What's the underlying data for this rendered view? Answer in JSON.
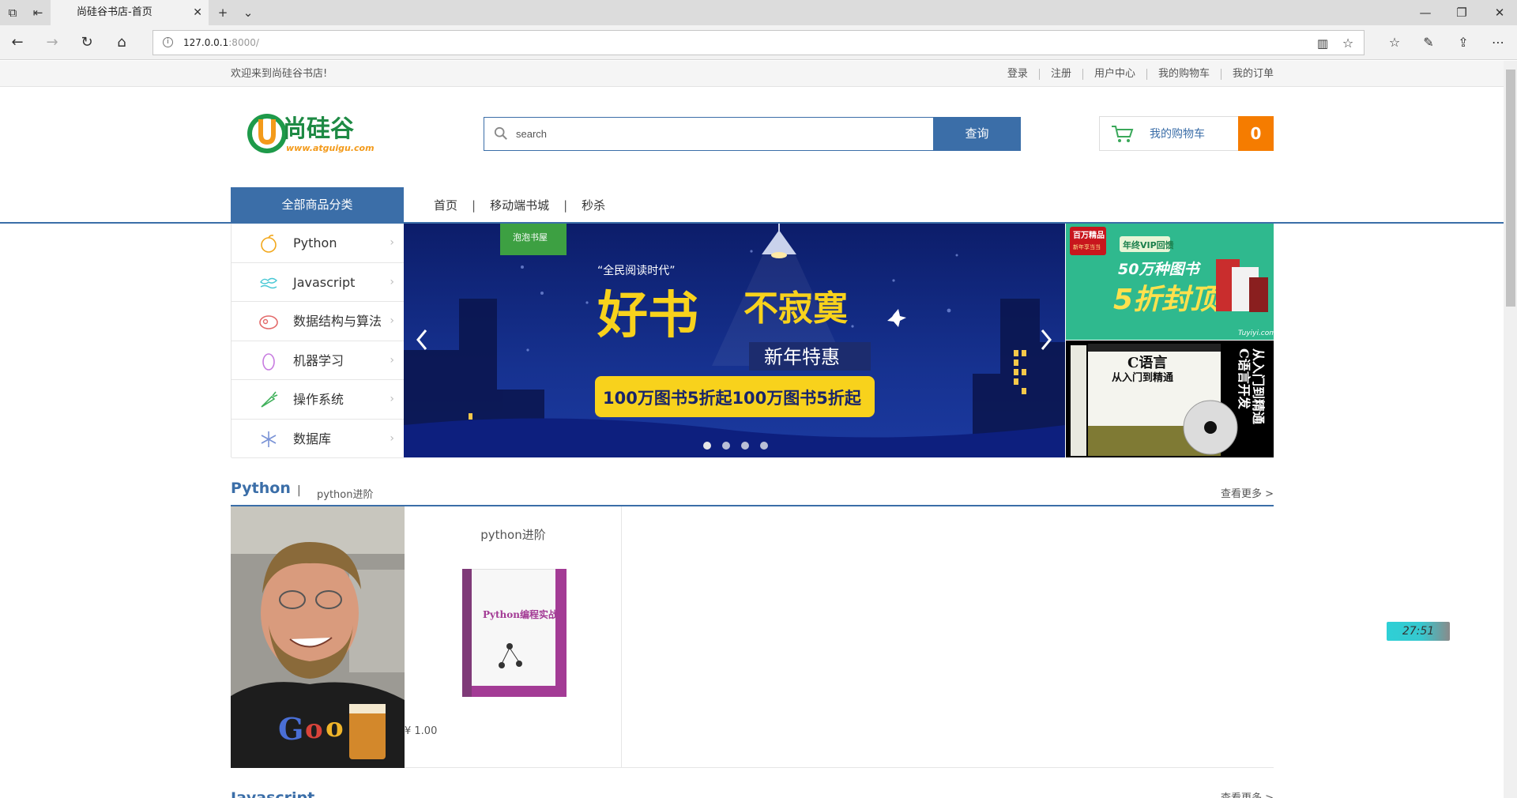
{
  "browser": {
    "tab_title": "尚硅谷书店-首页",
    "url_host": "127.0.0.1",
    "url_rest": ":8000/"
  },
  "topbar": {
    "welcome": "欢迎来到尚硅谷书店!",
    "links": [
      "登录",
      "注册",
      "用户中心",
      "我的购物车",
      "我的订单"
    ]
  },
  "logo": {
    "text": "尚硅谷",
    "url": "www.atguigu.com"
  },
  "search": {
    "placeholder": "search",
    "button": "查询"
  },
  "cart": {
    "label": "我的购物车",
    "count": "0"
  },
  "nav": {
    "all_categories": "全部商品分类",
    "links": [
      "首页",
      "移动端书城",
      "秒杀"
    ],
    "separator": "|"
  },
  "categories": [
    {
      "label": "Python",
      "icon": "orange-fruit-icon"
    },
    {
      "label": "Javascript",
      "icon": "cloud-wave-icon"
    },
    {
      "label": "数据结构与算法",
      "icon": "meat-icon"
    },
    {
      "label": "机器学习",
      "icon": "egg-icon"
    },
    {
      "label": "操作系统",
      "icon": "carrot-icon"
    },
    {
      "label": "数据库",
      "icon": "snowflake-icon"
    }
  ],
  "banner": {
    "tag": "泡泡书屋",
    "quote": "“全民阅读时代”",
    "headline_big": "好书",
    "headline_small": "不寂寞",
    "subtitle": "新年特惠",
    "promo": "100万图书5折起100万图书5折起",
    "dots": 4
  },
  "side_ads": {
    "ad1": {
      "badge": "百万精品",
      "badge2": "新年享当当",
      "pill": "年终VIP回馈",
      "line1": "50万种图书",
      "line2": "5折封顶",
      "site": "Tuyiyi.com"
    },
    "ad2": {
      "title": "C语言",
      "subtitle": "从入门到精通",
      "side": "从入门到精通",
      "vertical": "C语言开发"
    }
  },
  "section": {
    "title": "Python",
    "sep": "|",
    "subtitle": "python进阶",
    "more": "查看更多 >",
    "product": {
      "name": "python进阶",
      "price": "¥ 1.00",
      "cover_title": "Python编程实战"
    }
  },
  "next_section": {
    "title": "Javascript",
    "more": "查看更多 >"
  },
  "timer": "27:51",
  "colors": {
    "primary": "#3b6ea8",
    "cart_accent": "#f57c00",
    "banner_yellow": "#f8d21c"
  }
}
